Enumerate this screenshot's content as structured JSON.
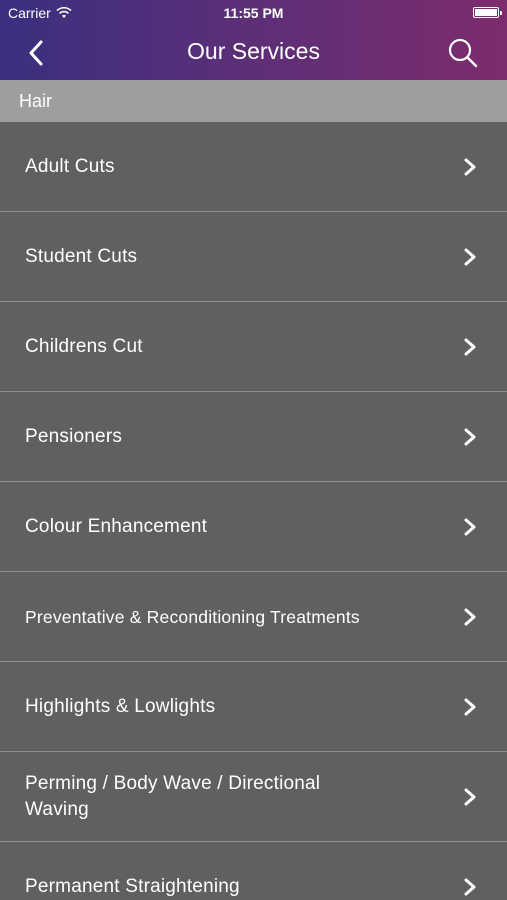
{
  "status_bar": {
    "carrier": "Carrier",
    "time": "11:55 PM"
  },
  "nav": {
    "title": "Our Services",
    "back_icon": "chevron-left-icon",
    "search_icon": "search-icon"
  },
  "section": {
    "title": "Hair"
  },
  "services": [
    {
      "label": "Adult Cuts"
    },
    {
      "label": "Student Cuts"
    },
    {
      "label": "Childrens Cut"
    },
    {
      "label": "Pensioners"
    },
    {
      "label": "Colour Enhancement"
    },
    {
      "label": "Preventative & Reconditioning Treatments"
    },
    {
      "label": "Highlights & Lowlights"
    },
    {
      "label": "Perming / Body Wave / Directional Waving"
    },
    {
      "label": "Permanent Straightening"
    }
  ],
  "colors": {
    "header_gradient_start": "#3a2f80",
    "header_gradient_end": "#7d2c6e",
    "section_bg": "#9d9ea0",
    "row_bg": "#5f6062",
    "divider": "#8d8e90",
    "text": "#ffffff"
  }
}
